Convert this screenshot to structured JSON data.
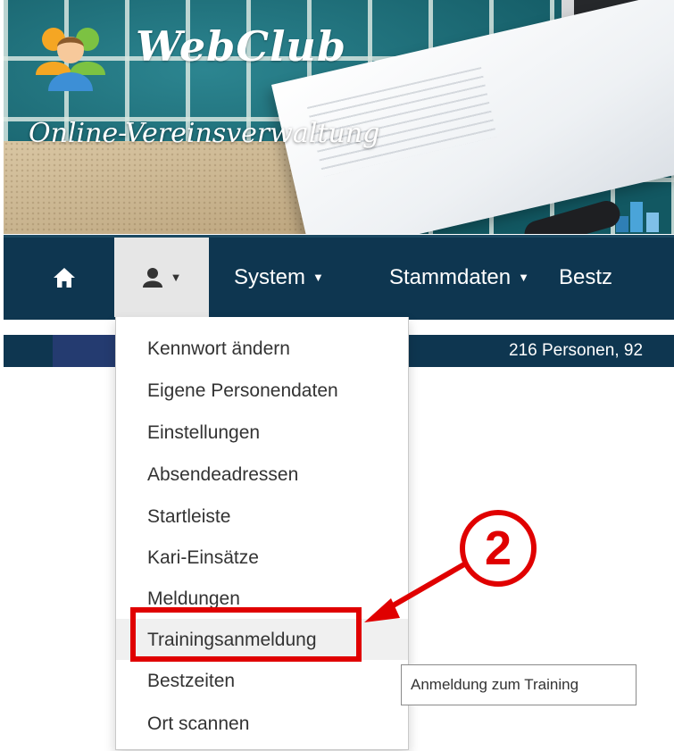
{
  "banner": {
    "brand": "WebClub",
    "tagline": "Online-Vereinsverwaltung",
    "logo_icon": "people-group-icon"
  },
  "navbar": {
    "home_icon": "home-icon",
    "user_icon": "user-icon",
    "items": [
      {
        "label": "System"
      },
      {
        "label": "Stammdaten"
      },
      {
        "label": "Bestz"
      }
    ]
  },
  "status": {
    "text": "216 Personen, 92"
  },
  "dropdown": {
    "items": [
      {
        "label": "Kennwort ändern"
      },
      {
        "label": "Eigene Personendaten"
      },
      {
        "label": "Einstellungen"
      },
      {
        "label": "Absendeadressen"
      },
      {
        "label": "Startleiste"
      },
      {
        "label": "Kari-Einsätze"
      },
      {
        "label": "Meldungen"
      },
      {
        "label": "Trainingsanmeldung"
      },
      {
        "label": "Bestzeiten"
      },
      {
        "label": "Ort scannen"
      }
    ],
    "hovered": "Trainingsanmeldung"
  },
  "annotation": {
    "step": "2",
    "color": "#e00000"
  },
  "tooltip": {
    "text": "Anmeldung zum Training"
  },
  "colors": {
    "navbar": "#0e3650",
    "active_nav_bg": "#e6e6e6"
  }
}
